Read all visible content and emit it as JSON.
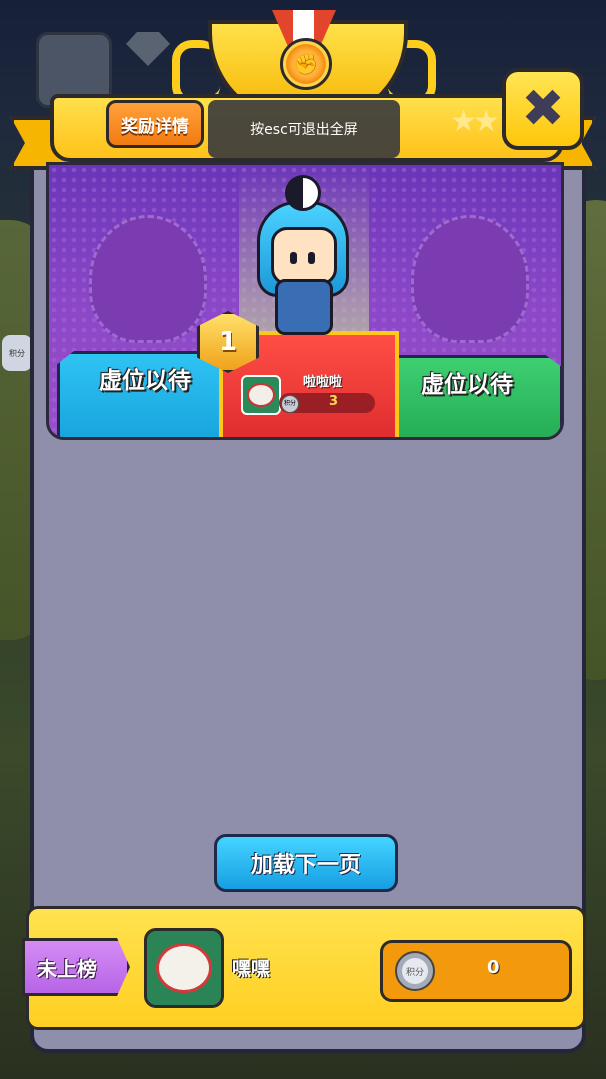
{
  "header": {
    "reward_details_label": "奖励详情",
    "close_label": "✖"
  },
  "toast": {
    "text": "按esc可退出全屏"
  },
  "podium": {
    "left_vacant": "虚位以待",
    "right_vacant": "虚位以待",
    "first": {
      "rank": "1",
      "name": "啦啦啦",
      "score": "3",
      "score_icon": "积分"
    }
  },
  "load_more_label": "加载下一页",
  "me": {
    "rank_label": "未上榜",
    "name": "嘿嘿",
    "score": "0",
    "score_icon": "积分"
  },
  "background": {
    "side_button_label": "积分"
  },
  "colors": {
    "panel": "#8f8fab",
    "banner": "#ffc21a",
    "stage": "#8a47c7"
  }
}
